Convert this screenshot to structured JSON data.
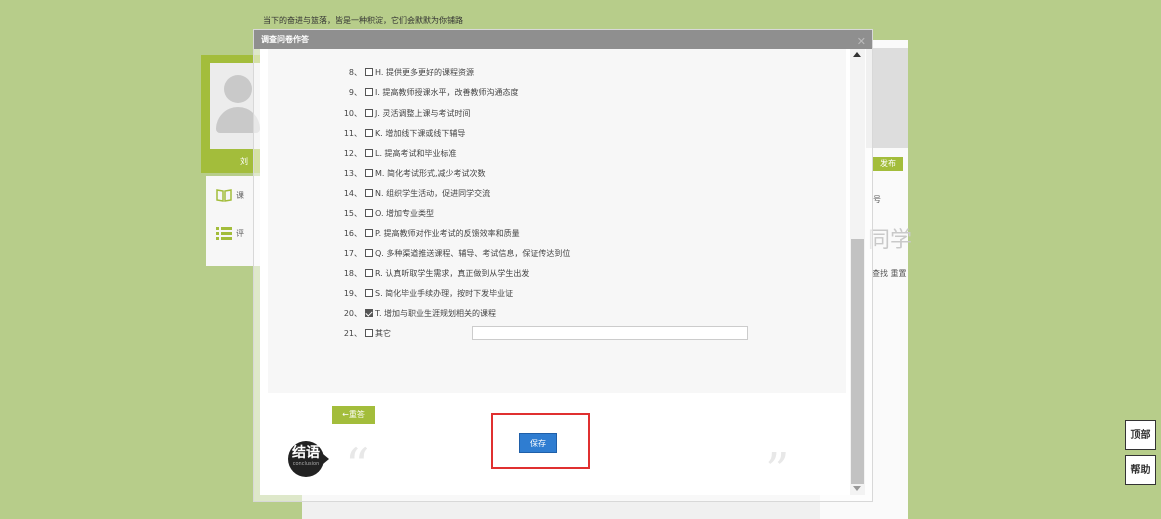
{
  "page": {
    "tagline": "当下的奋进与篮落，皆是一种积淀，它们会默默为你铺路",
    "profile_name": "刘",
    "side_nav": [
      {
        "label": "课",
        "icon": "book-icon"
      },
      {
        "label": "评",
        "icon": "list-icon"
      }
    ],
    "publish_label": "发布",
    "right_text_1": "号",
    "right_big_text": "同学",
    "right_text_2": "查找 重置"
  },
  "floating": {
    "top_label": "顶部",
    "help_label": "帮助"
  },
  "modal": {
    "title": "调查问卷作答",
    "options": [
      {
        "num": "8、",
        "label": "H. 提供更多更好的课程资源",
        "checked": false
      },
      {
        "num": "9、",
        "label": "I. 提高教师授课水平，改善教师沟通态度",
        "checked": false
      },
      {
        "num": "10、",
        "label": "J. 灵活调整上课与考试时间",
        "checked": false
      },
      {
        "num": "11、",
        "label": "K. 增加线下课或线下辅导",
        "checked": false
      },
      {
        "num": "12、",
        "label": "L. 提高考试和毕业标准",
        "checked": false
      },
      {
        "num": "13、",
        "label": "M. 简化考试形式,减少考试次数",
        "checked": false
      },
      {
        "num": "14、",
        "label": "N. 组织学生活动，促进同学交流",
        "checked": false
      },
      {
        "num": "15、",
        "label": "O. 增加专业类型",
        "checked": false
      },
      {
        "num": "16、",
        "label": "P. 提高教师对作业考试的反馈效率和质量",
        "checked": false
      },
      {
        "num": "17、",
        "label": "Q. 多种渠道推送课程、辅导、考试信息，保证传达到位",
        "checked": false
      },
      {
        "num": "18、",
        "label": "R. 认真听取学生需求，真正做到从学生出发",
        "checked": false
      },
      {
        "num": "19、",
        "label": "S. 简化毕业手续办理，按时下发毕业证",
        "checked": false
      },
      {
        "num": "20、",
        "label": "T. 增加与职业生涯规划相关的课程",
        "checked": true
      },
      {
        "num": "21、",
        "label": "其它",
        "checked": false
      }
    ],
    "reset_label": "←重答",
    "conclusion_title": "结语",
    "conclusion_sub": "conclusion",
    "quote_open": "“",
    "quote_close": "”",
    "save_label": "保存"
  }
}
